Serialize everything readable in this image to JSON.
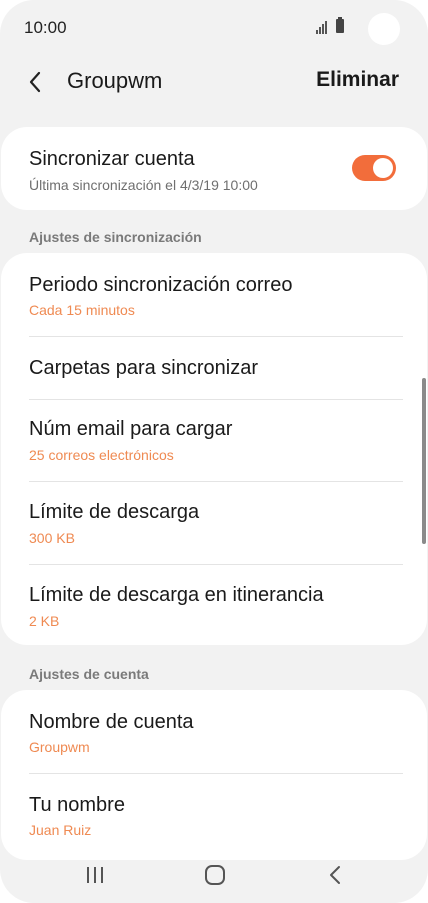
{
  "status_bar": {
    "time": "10:00"
  },
  "app_bar": {
    "title": "Groupwm",
    "delete_label": "Eliminar"
  },
  "sync_card": {
    "title": "Sincronizar cuenta",
    "subtitle": "Última sincronización el 4/3/19  10:00",
    "toggle_on": true
  },
  "sections": [
    {
      "header": "Ajustes de sincronización",
      "items": [
        {
          "title": "Periodo sincronización correo",
          "value": "Cada 15 minutos"
        },
        {
          "title": "Carpetas para sincronizar",
          "value": ""
        },
        {
          "title": "Núm email para cargar",
          "value": "25 correos electrónicos"
        },
        {
          "title": "Límite de descarga",
          "value": "300 KB"
        },
        {
          "title": "Límite de descarga en itinerancia",
          "value": "2 KB"
        }
      ]
    },
    {
      "header": "Ajustes de cuenta",
      "items": [
        {
          "title": "Nombre de cuenta",
          "value": "Groupwm"
        },
        {
          "title": "Tu nombre",
          "value": "Juan Ruiz"
        }
      ]
    }
  ],
  "colors": {
    "accent": "#f26d3b",
    "value_text": "#ef8a52",
    "background": "#f2f2f2"
  },
  "icons": {
    "back": "back-arrow-icon",
    "nav_recents": "recent-apps-icon",
    "nav_home": "home-icon",
    "nav_back": "nav-back-icon"
  }
}
